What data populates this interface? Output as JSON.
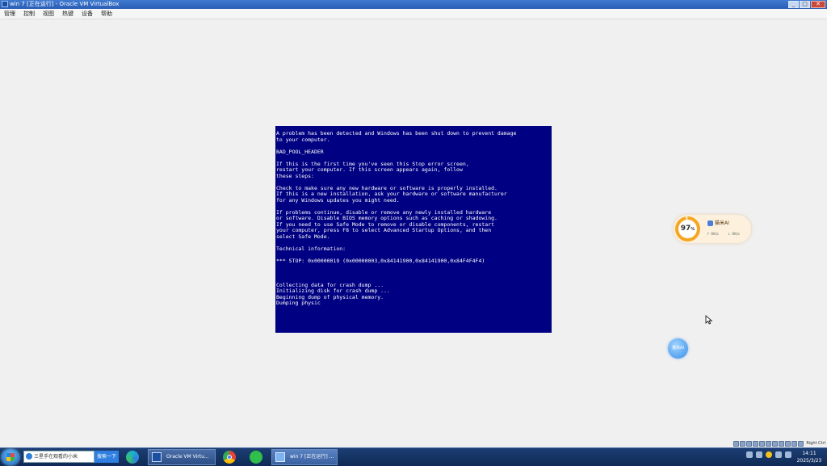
{
  "window": {
    "title": "win 7 [正在运行] - Oracle VM VirtualBox",
    "controls": {
      "minimize": "_",
      "maximize": "□",
      "close": "✕"
    }
  },
  "menu": [
    "管理",
    "控制",
    "视图",
    "热键",
    "设备",
    "帮助"
  ],
  "bsod": {
    "lines": [
      "A problem has been detected and Windows has been shut down to prevent damage",
      "to your computer.",
      "",
      "BAD_POOL_HEADER",
      "",
      "If this is the first time you've seen this Stop error screen,",
      "restart your computer. If this screen appears again, follow",
      "these steps:",
      "",
      "Check to make sure any new hardware or software is properly installed.",
      "If this is a new installation, ask your hardware or software manufacturer",
      "for any Windows updates you might need.",
      "",
      "If problems continue, disable or remove any newly installed hardware",
      "or software. Disable BIOS memory options such as caching or shadowing.",
      "If you need to use Safe Mode to remove or disable components, restart",
      "your computer, press F8 to select Advanced Startup Options, and then",
      "select Safe Mode.",
      "",
      "Technical information:",
      "",
      "*** STOP: 0x00000019 (0x00000003,0x84141900,0x84141900,0x84F4F4F4)",
      "",
      "",
      "",
      "Collecting data for crash dump ...",
      "Initializing disk for crash dump ...",
      "Beginning dump of physical memory.",
      "Dumping physic"
    ]
  },
  "widget": {
    "percent": "97",
    "percent_unit": "%",
    "brand": "猫米AI",
    "upload": "0K/s",
    "download": "0K/s",
    "accent_color": "#f5a623"
  },
  "bubble": {
    "label": "猫米AI"
  },
  "status_strip": {
    "host_key": "Right Ctrl"
  },
  "taskbar": {
    "search_text": "三星手在观看的小米",
    "search_button": "搜索一下",
    "tasks": [
      {
        "label": "Oracle VM Virtu...",
        "icon": "virtualbox-icon"
      },
      {
        "label": "win 7 [正在运行] ...",
        "icon": "vm-window-icon"
      }
    ],
    "clock_time": "14:11",
    "clock_date": "2025/3/23"
  }
}
